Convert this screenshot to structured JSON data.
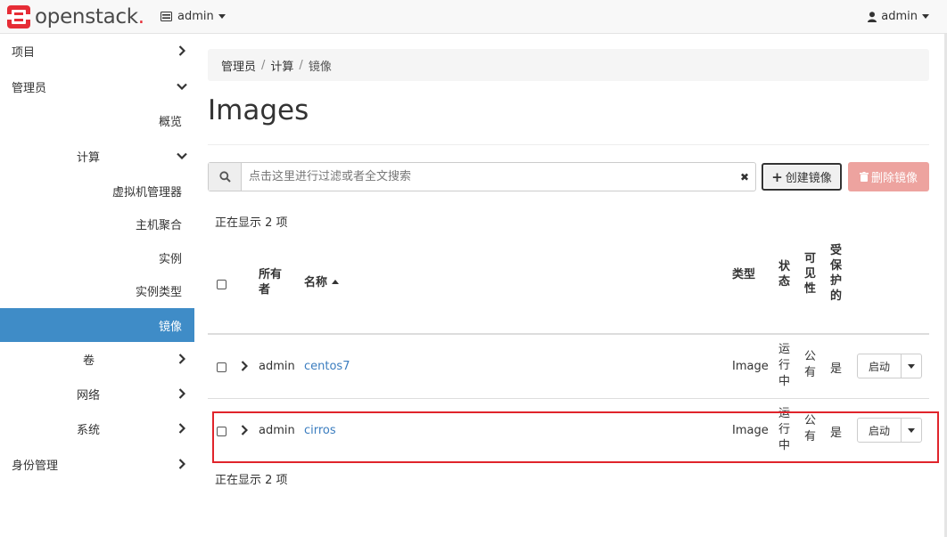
{
  "header": {
    "brand": "openstack",
    "brand_dot": ".",
    "project_label": "admin",
    "user_label": "admin"
  },
  "sidebar": {
    "items": [
      {
        "label": "项目"
      },
      {
        "label": "管理员"
      },
      {
        "label": "概览"
      },
      {
        "label": "计算"
      },
      {
        "label": "虚拟机管理器"
      },
      {
        "label": "主机聚合"
      },
      {
        "label": "实例"
      },
      {
        "label": "实例类型"
      },
      {
        "label": "镜像"
      },
      {
        "label": "卷"
      },
      {
        "label": "网络"
      },
      {
        "label": "系统"
      },
      {
        "label": "身份管理"
      }
    ]
  },
  "breadcrumb": [
    "管理员",
    "计算",
    "镜像"
  ],
  "breadcrumb_sep": "/",
  "page_title": "Images",
  "search": {
    "placeholder": "点击这里进行过滤或者全文搜索",
    "clear_glyph": "✖"
  },
  "actions": {
    "create_label": "创建镜像",
    "create_glyph": "+",
    "delete_label": "删除镜像"
  },
  "count_text": "正在显示 2 项",
  "table": {
    "headers": {
      "owner": "所有者",
      "name": "名称",
      "type": "类型",
      "status": "状态",
      "visibility": "可见性",
      "protected": "受保护的"
    },
    "rows": [
      {
        "owner": "admin",
        "name": "centos7",
        "type": "Image",
        "status": "运行中",
        "visibility": "公有",
        "protected": "是",
        "action": "启动"
      },
      {
        "owner": "admin",
        "name": "cirros",
        "type": "Image",
        "status": "运行中",
        "visibility": "公有",
        "protected": "是",
        "action": "启动"
      }
    ]
  },
  "colors": {
    "accent": "#3f8cc7",
    "link": "#3b7dbf",
    "danger_disabled": "#eda39f",
    "brand_red": "#e62d36",
    "highlight": "#e0242b"
  },
  "icons": {
    "brand": "openstack-logo-icon",
    "project": "server-stack-icon",
    "user": "user-icon",
    "search": "search-icon",
    "clear": "close-icon",
    "trash": "trash-icon",
    "expand": "chevron-right-icon",
    "collapse": "chevron-down-icon"
  }
}
